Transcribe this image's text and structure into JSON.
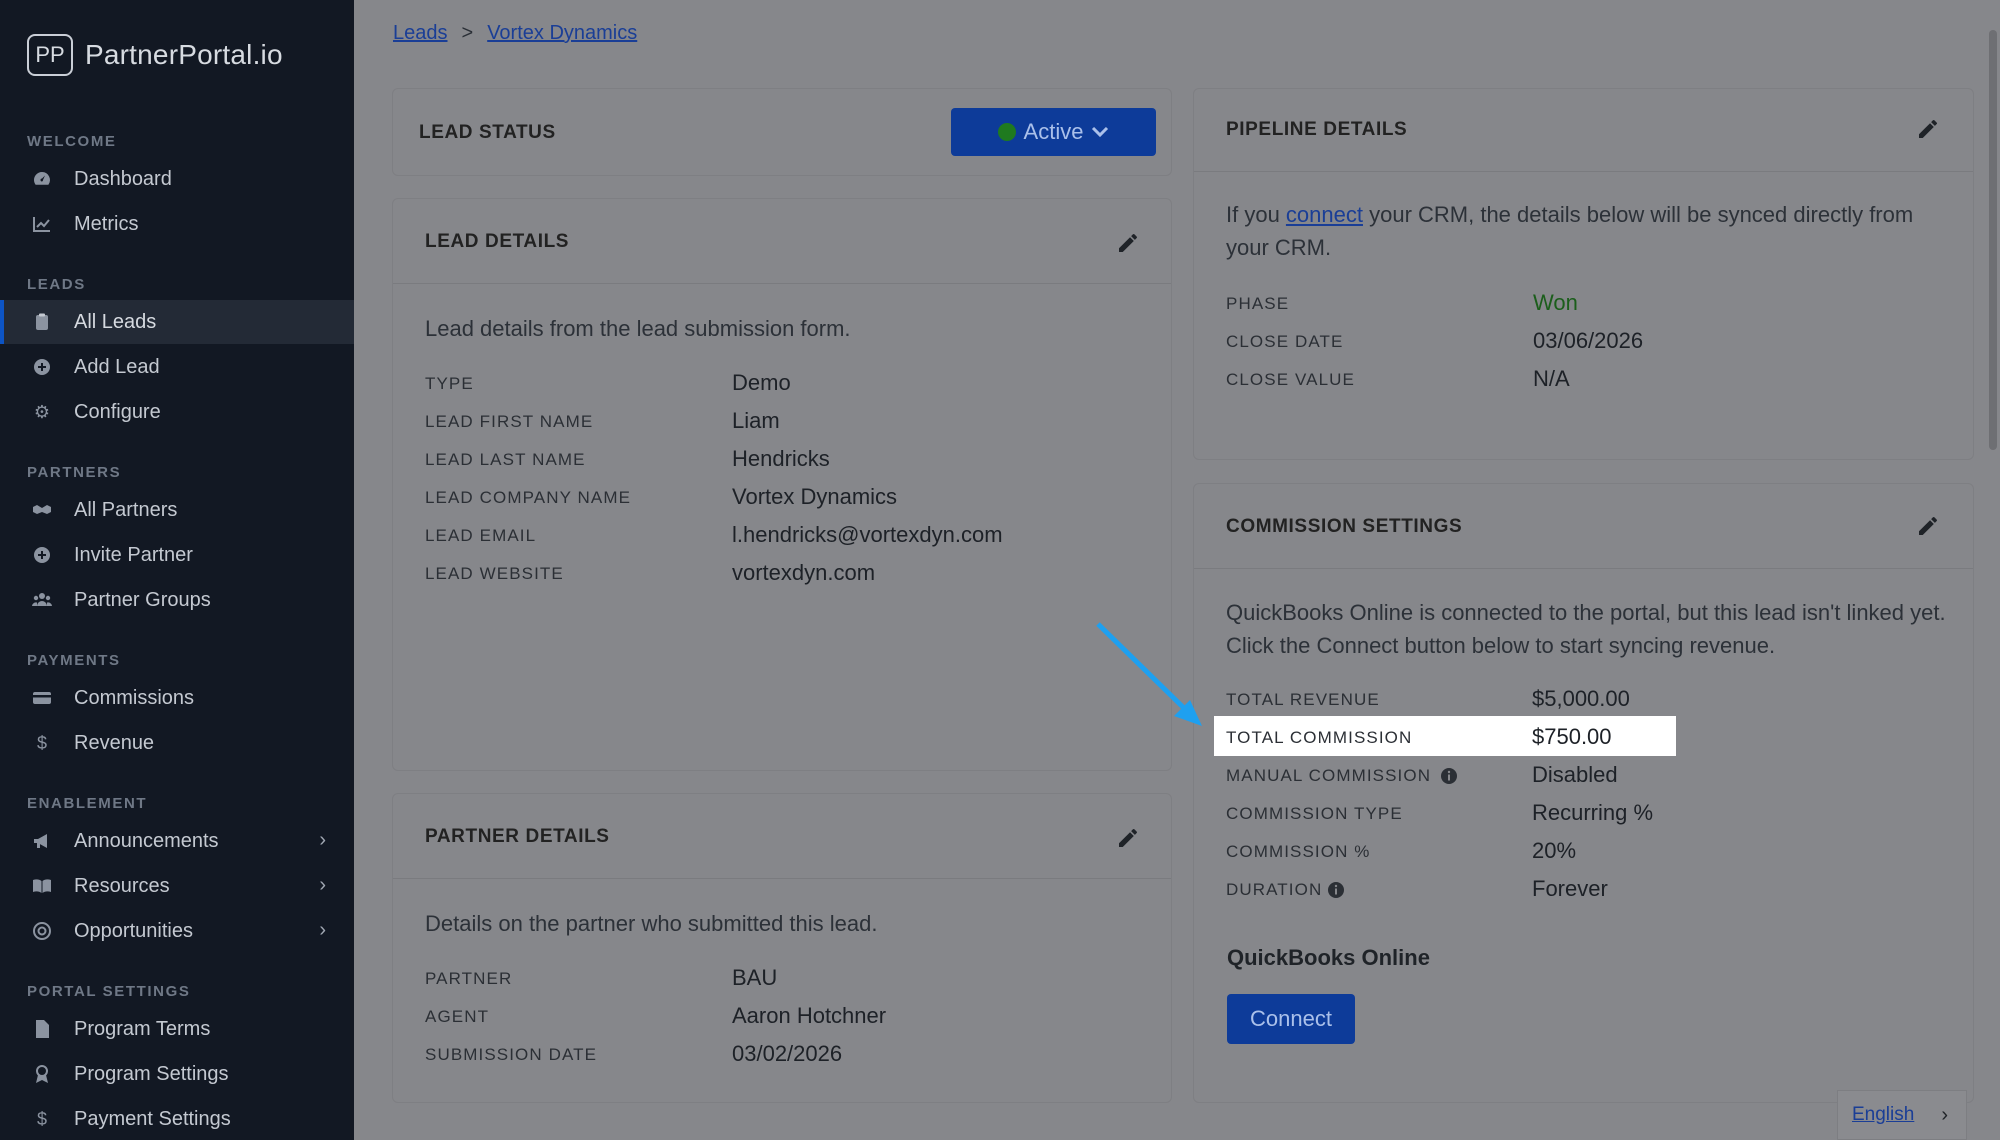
{
  "brand": {
    "logo_mark": "PP",
    "name": "PartnerPortal.io"
  },
  "sidebar": {
    "sections": [
      {
        "title": "WELCOME",
        "items": [
          {
            "label": "Dashboard",
            "icon": "gauge-icon"
          },
          {
            "label": "Metrics",
            "icon": "chart-line-icon"
          }
        ]
      },
      {
        "title": "LEADS",
        "items": [
          {
            "label": "All Leads",
            "icon": "clipboard-icon",
            "active": true
          },
          {
            "label": "Add Lead",
            "icon": "plus-circle-icon"
          },
          {
            "label": "Configure",
            "icon": "gear-icon"
          }
        ]
      },
      {
        "title": "PARTNERS",
        "items": [
          {
            "label": "All Partners",
            "icon": "handshake-icon"
          },
          {
            "label": "Invite Partner",
            "icon": "plus-circle-icon"
          },
          {
            "label": "Partner Groups",
            "icon": "users-icon"
          }
        ]
      },
      {
        "title": "PAYMENTS",
        "items": [
          {
            "label": "Commissions",
            "icon": "credit-card-icon"
          },
          {
            "label": "Revenue",
            "icon": "dollar-icon"
          }
        ]
      },
      {
        "title": "ENABLEMENT",
        "items": [
          {
            "label": "Announcements",
            "icon": "megaphone-icon"
          },
          {
            "label": "Resources",
            "icon": "book-icon"
          },
          {
            "label": "Opportunities",
            "icon": "target-icon"
          }
        ]
      },
      {
        "title": "PORTAL SETTINGS",
        "items": [
          {
            "label": "Program Terms",
            "icon": "file-icon"
          },
          {
            "label": "Program Settings",
            "icon": "award-icon"
          },
          {
            "label": "Payment Settings",
            "icon": "dollar-icon"
          }
        ]
      }
    ]
  },
  "breadcrumb": {
    "items": [
      "Leads",
      "Vortex Dynamics"
    ],
    "separator": ">"
  },
  "lead_status": {
    "title": "LEAD STATUS",
    "value": "Active",
    "status_color": "#1f7a1f"
  },
  "lead_details": {
    "title": "LEAD DETAILS",
    "description": "Lead details from the lead submission form.",
    "rows": [
      {
        "label": "TYPE",
        "value": "Demo"
      },
      {
        "label": "LEAD FIRST NAME",
        "value": "Liam"
      },
      {
        "label": "LEAD LAST NAME",
        "value": "Hendricks"
      },
      {
        "label": "LEAD COMPANY NAME",
        "value": "Vortex Dynamics"
      },
      {
        "label": "LEAD EMAIL",
        "value": "l.hendricks@vortexdyn.com"
      },
      {
        "label": "LEAD WEBSITE",
        "value": "vortexdyn.com"
      }
    ]
  },
  "partner_details": {
    "title": "PARTNER DETAILS",
    "description": "Details on the partner who submitted this lead.",
    "rows": [
      {
        "label": "PARTNER",
        "value": "BAU"
      },
      {
        "label": "AGENT",
        "value": "Aaron Hotchner"
      },
      {
        "label": "SUBMISSION DATE",
        "value": "03/02/2026"
      }
    ]
  },
  "pipeline_details": {
    "title": "PIPELINE DETAILS",
    "desc_before": "If you ",
    "desc_link": "connect",
    "desc_after": " your CRM, the details below will be synced directly from your CRM.",
    "rows": [
      {
        "label": "PHASE",
        "value": "Won"
      },
      {
        "label": "CLOSE DATE",
        "value": "03/06/2026"
      },
      {
        "label": "CLOSE VALUE",
        "value": "N/A"
      }
    ],
    "won_color": "#1b5e1b"
  },
  "commission_settings": {
    "title": "COMMISSION SETTINGS",
    "description": "QuickBooks Online is connected to the portal, but this lead isn't linked yet. Click the Connect button below to start syncing revenue.",
    "rows": [
      {
        "label": "TOTAL REVENUE",
        "value": "$5,000.00"
      },
      {
        "label": "TOTAL COMMISSION",
        "value": "$750.00"
      },
      {
        "label": "MANUAL COMMISSION",
        "value": "Disabled"
      },
      {
        "label": "COMMISSION TYPE",
        "value": "Recurring %"
      },
      {
        "label": "COMMISSION %",
        "value": "20%"
      },
      {
        "label": "DURATION",
        "value": "Forever"
      }
    ],
    "integration_title": "QuickBooks Online",
    "connect_label": "Connect"
  },
  "language": {
    "label": "English"
  },
  "accent_color": "#0d3b99"
}
